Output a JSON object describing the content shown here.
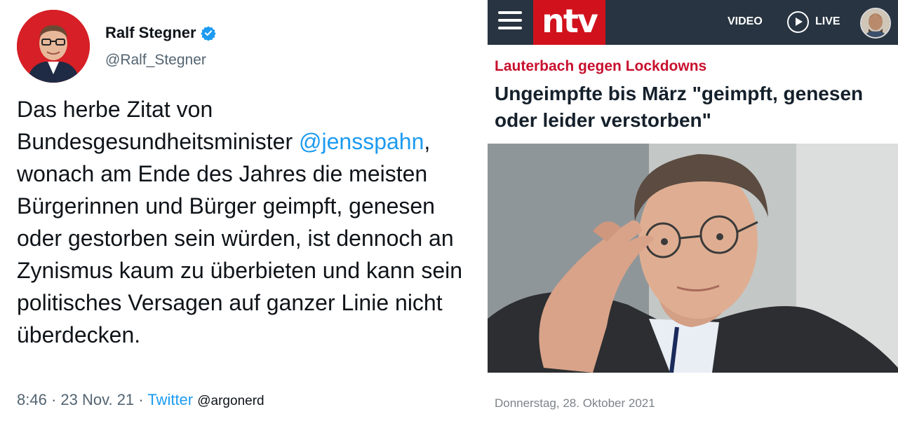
{
  "tweet": {
    "display_name": "Ralf Stegner",
    "handle": "@Ralf_Stegner",
    "text_before_mention": "Das herbe Zitat von Bundesgesundheitsminister ",
    "mention": "@jensspahn",
    "text_after_mention": ", wonach am Ende des Jahres die meisten Bürgerinnen und Bürger geimpft, genesen oder gestorben sein würden, ist dennoch an Zynismus kaum zu überbieten und kann sein politisches Versagen auf ganzer Linie nicht überdecken.",
    "time": "8:46",
    "separator": " · ",
    "date": "23 Nov. 21",
    "source": "Twitter",
    "watermark": "@argonerd",
    "avatar_icon": "person-portrait",
    "verified_icon": "verified-badge-icon"
  },
  "ntv": {
    "logo": "ntv",
    "nav_video": "VIDEO",
    "nav_live": "LIVE",
    "kicker": "Lauterbach gegen Lockdowns",
    "headline": "Ungeimpfte bis März \"geimpft, genesen oder leider verstorben\"",
    "dateline": "Donnerstag, 28. Oktober 2021",
    "colors": {
      "header": "#283441",
      "brand_red": "#d1121c",
      "kicker_red": "#c8102e"
    }
  }
}
